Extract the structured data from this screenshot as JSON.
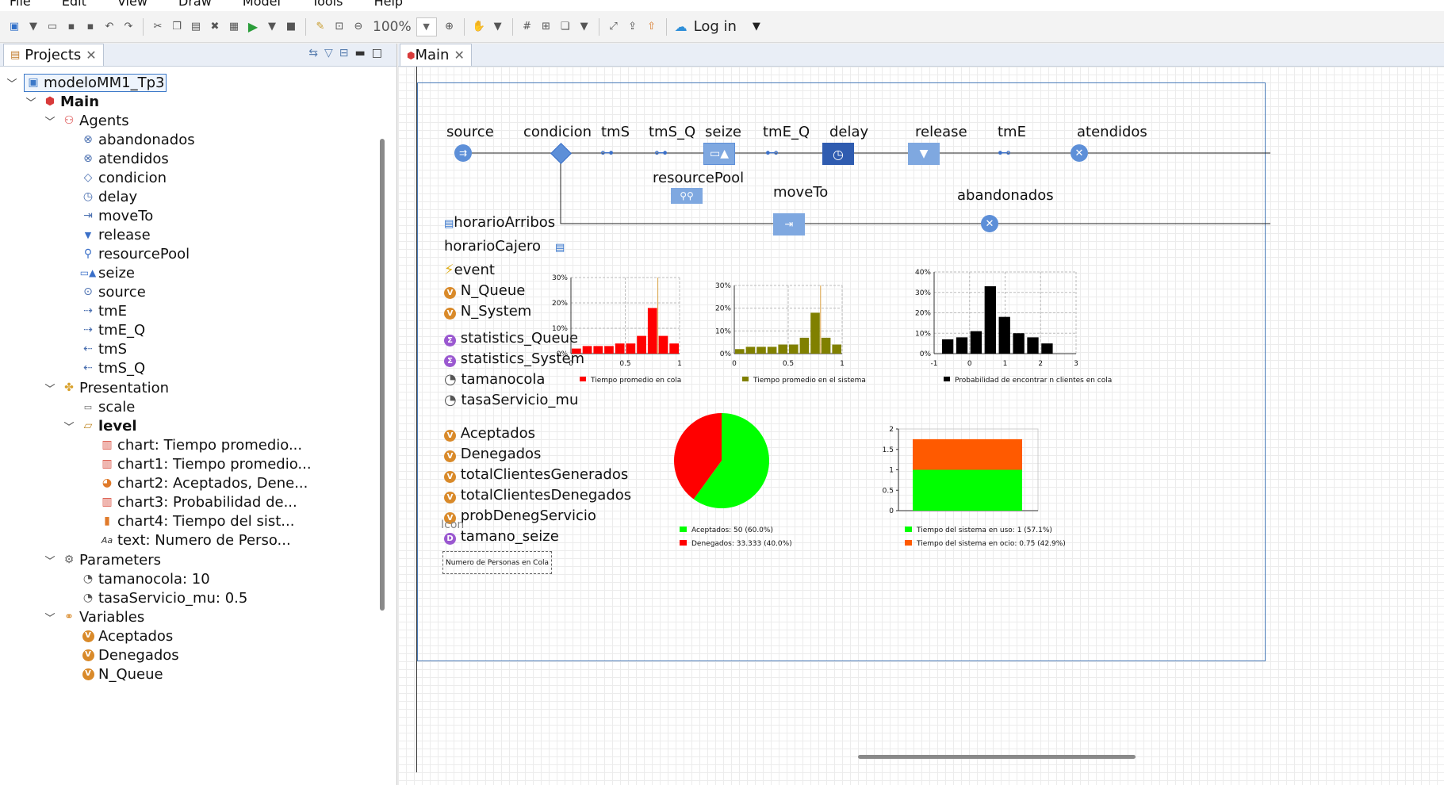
{
  "menu": [
    "File",
    "Edit",
    "View",
    "Draw",
    "Model",
    "Tools",
    "Help"
  ],
  "toolbar": {
    "zoom": "100%",
    "login": "Log in"
  },
  "projects_tab": {
    "label": "Projects"
  },
  "main_tab": {
    "label": "Main"
  },
  "tree": {
    "model": "modeloMM1_Tp3",
    "main": "Main",
    "agents_label": "Agents",
    "agents": [
      "abandonados",
      "atendidos",
      "condicion",
      "delay",
      "moveTo",
      "release",
      "resourcePool",
      "seize",
      "source",
      "tmE",
      "tmE_Q",
      "tmS",
      "tmS_Q"
    ],
    "presentation_label": "Presentation",
    "scale": "scale",
    "level": "level",
    "level_items": [
      "chart: Tiempo promedio...",
      "chart1: Tiempo promedio...",
      "chart2: Aceptados, Dene...",
      "chart3: Probabilidad de...",
      "chart4: Tiempo del sist...",
      "text: Numero de Perso..."
    ],
    "parameters_label": "Parameters",
    "parameters": [
      "tamanocola: 10",
      "tasaServicio_mu: 0.5"
    ],
    "variables_label": "Variables",
    "variables": [
      "Aceptados",
      "Denegados",
      "N_Queue"
    ]
  },
  "flow": {
    "source": "source",
    "condicion": "condicion",
    "tmS": "tmS",
    "tmS_Q": "tmS_Q",
    "seize": "seize",
    "tmE_Q": "tmE_Q",
    "delay": "delay",
    "release": "release",
    "tmE": "tmE",
    "atendidos": "atendidos",
    "resourcePool": "resourcePool",
    "moveTo": "moveTo",
    "abandonados": "abandonados"
  },
  "canvas_items": {
    "horarioArribos": "horarioArribos",
    "horarioCajero": "horarioCajero",
    "event": "event",
    "n_queue": "N_Queue",
    "n_system": "N_System",
    "statistics_queue": "statistics_Queue",
    "statistics_system": "statistics_System",
    "tamanocola": "tamanocola",
    "tasaservicio": "tasaServicio_mu",
    "aceptados": "Aceptados",
    "denegados": "Denegados",
    "total_generados": "totalClientesGenerados",
    "total_denegados": "totalClientesDenegados",
    "prob_deneg": "probDenegServicio",
    "tamano_seize": "tamano_seize",
    "icon": "Icon",
    "text_box": "Numero de Personas en Cola"
  },
  "colors": {
    "red": "#ff0000",
    "olive": "#808000",
    "black": "#000000",
    "green": "#00ff00",
    "orange": "#ff5a00",
    "node_blue": "#5d8fd8"
  },
  "chart_data": [
    {
      "type": "bar",
      "legend": "Tiempo promedio en cola",
      "xlim": [
        0,
        1
      ],
      "ylim": [
        0,
        30
      ],
      "x_ticks": [
        "0",
        "0.5",
        "1"
      ],
      "y_ticks": [
        "0%",
        "10%",
        "20%",
        "30%"
      ],
      "values": [
        2,
        3,
        3,
        3,
        4,
        4,
        7,
        18,
        7,
        4
      ],
      "mean_line": 0.75
    },
    {
      "type": "bar",
      "legend": "Tiempo promedio en el sistema",
      "xlim": [
        0,
        1
      ],
      "ylim": [
        0,
        30
      ],
      "x_ticks": [
        "0",
        "0.5",
        "1"
      ],
      "y_ticks": [
        "0%",
        "10%",
        "20%",
        "30%"
      ],
      "values": [
        2,
        3,
        3,
        3,
        4,
        4,
        7,
        18,
        7,
        4
      ],
      "mean_line": 0.75
    },
    {
      "type": "bar",
      "legend": "Probabilidad de encontrar n clientes en cola",
      "xlim": [
        -1,
        3
      ],
      "ylim": [
        0,
        40
      ],
      "x_ticks": [
        "-1",
        "0",
        "1",
        "2",
        "3"
      ],
      "y_ticks": [
        "0%",
        "10%",
        "20%",
        "30%",
        "40%"
      ],
      "x": [
        -0.8,
        -0.4,
        0,
        0.4,
        0.8,
        1.2,
        1.6,
        2.0
      ],
      "values": [
        7,
        8,
        11,
        33,
        18,
        10,
        8,
        5
      ]
    },
    {
      "type": "pie",
      "slices": [
        {
          "label": "Aceptados: 50 (60.0%)",
          "value": 60.0
        },
        {
          "label": "Denegados: 33.333 (40.0%)",
          "value": 40.0
        }
      ]
    },
    {
      "type": "bar",
      "stacked": true,
      "ylim": [
        0,
        2
      ],
      "y_ticks": [
        "0",
        "0.5",
        "1",
        "1.5",
        "2"
      ],
      "series": [
        {
          "name": "Tiempo del sistema en uso: 1 (57.1%)",
          "values": [
            1
          ]
        },
        {
          "name": "Tiempo del sistema en ocio: 0.75 (42.9%)",
          "values": [
            0.75
          ]
        }
      ]
    }
  ]
}
